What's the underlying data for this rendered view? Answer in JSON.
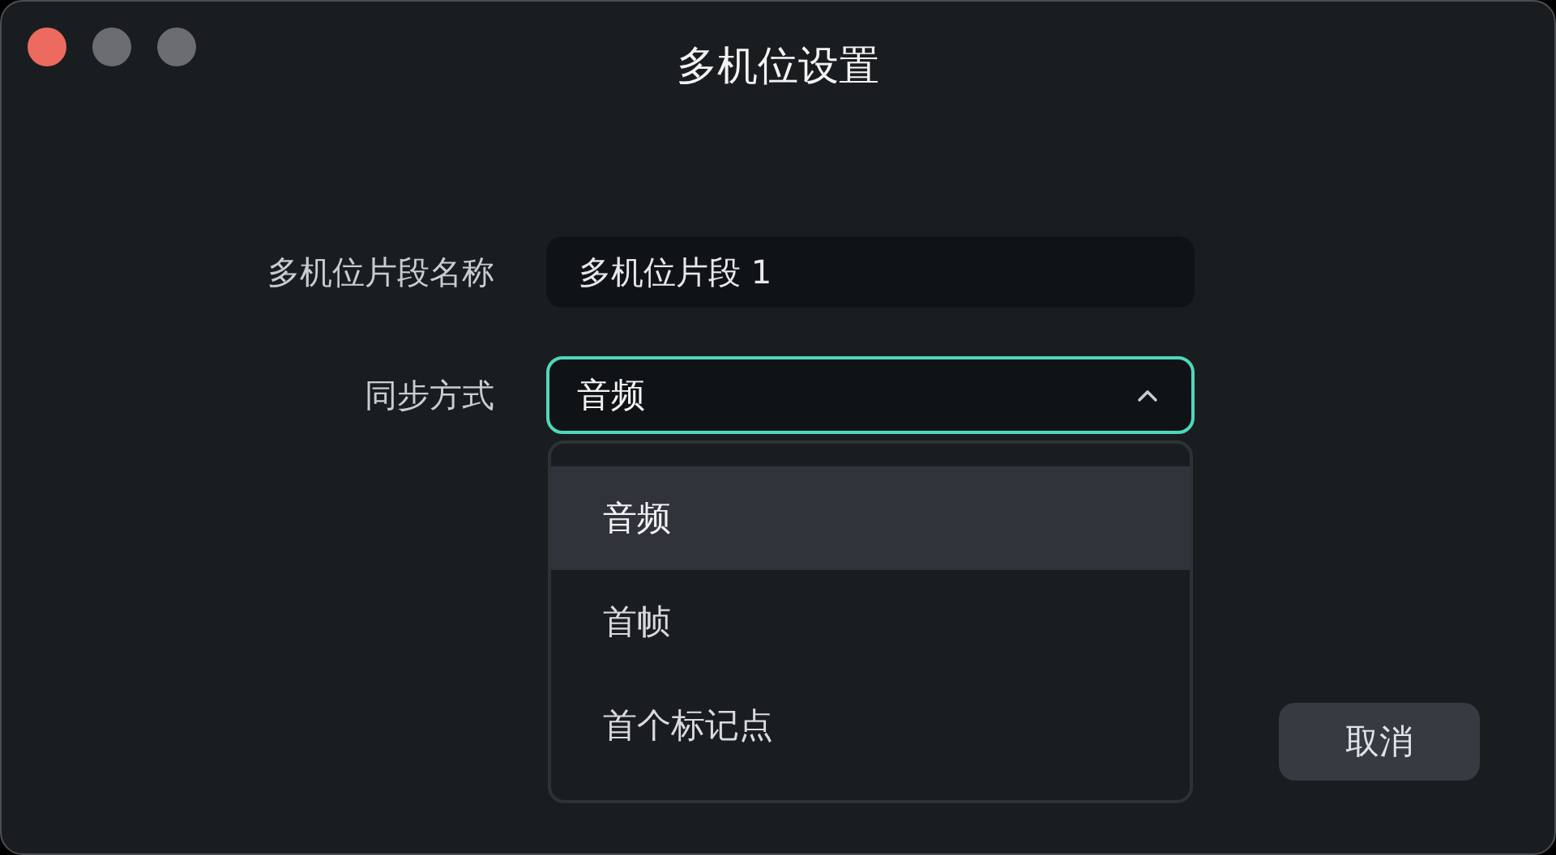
{
  "window": {
    "title": "多机位设置"
  },
  "name_field": {
    "label": "多机位片段名称",
    "value": "多机位片段 1"
  },
  "sync": {
    "label": "同步方式",
    "value": "音频",
    "expanded": true,
    "options": [
      {
        "label": "音频",
        "selected": true
      },
      {
        "label": "首帧",
        "selected": false
      },
      {
        "label": "首个标记点",
        "selected": false
      }
    ]
  },
  "buttons": [
    {
      "label": "取消"
    }
  ]
}
